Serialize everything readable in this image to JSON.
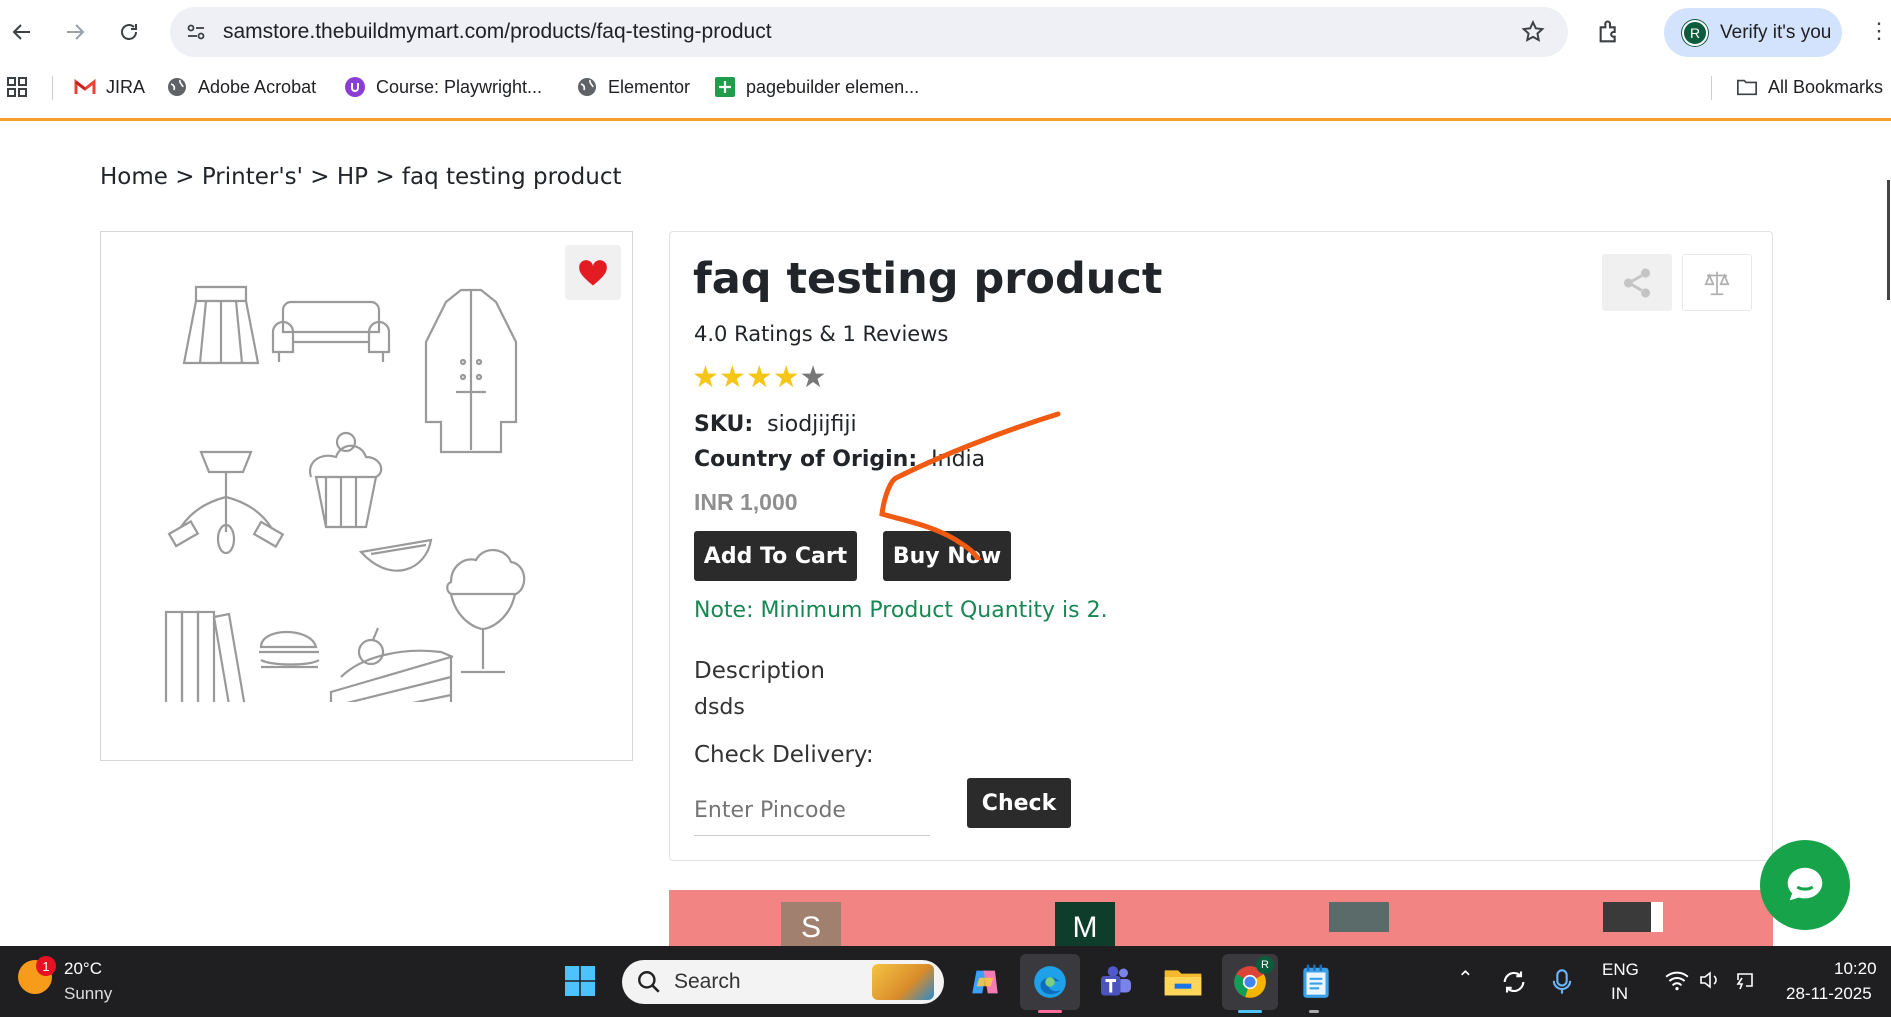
{
  "browser": {
    "url": "samstore.thebuildmymart.com/products/faq-testing-product",
    "profile_label": "Verify it's you",
    "profile_initial": "R",
    "bookmarks": [
      {
        "label": "JIRA",
        "icon": "gmail-icon"
      },
      {
        "label": "Adobe Acrobat",
        "icon": "globe-icon"
      },
      {
        "label": "Course: Playwright...",
        "icon": "course-icon"
      },
      {
        "label": "Elementor",
        "icon": "globe-icon"
      },
      {
        "label": "pagebuilder elemen...",
        "icon": "sheets-icon"
      }
    ],
    "all_bookmarks": "All Bookmarks"
  },
  "breadcrumb": "Home > Printer's' > HP > faq testing product",
  "product": {
    "title": "faq testing product",
    "ratings_text": "4.0 Ratings & 1 Reviews",
    "rating": 4,
    "rating_max": 5,
    "sku_label": "SKU:",
    "sku_value": "siodjijfiji",
    "origin_label": "Country of Origin:",
    "origin_value": "India",
    "price": "INR 1,000",
    "add_to_cart": "Add To Cart",
    "buy_now": "Buy Now",
    "note": "Note: Minimum Product Quantity is 2.",
    "description_label": "Description",
    "description_value": "dsds",
    "check_delivery_label": "Check Delivery:",
    "pincode_placeholder": "Enter Pincode",
    "check_button": "Check"
  },
  "related_tiles": [
    "S",
    "M"
  ],
  "colors": {
    "accent_orange": "#f59e2a",
    "note_green": "#198754",
    "band": "#f28584",
    "chat": "#16a34a",
    "star": "#f5c518"
  },
  "taskbar": {
    "weather_temp": "20°C",
    "weather_desc": "Sunny",
    "weather_badge": "1",
    "search_label": "Search",
    "lang_top": "ENG",
    "lang_bottom": "IN",
    "time": "10:20",
    "date": "28-11-2025"
  }
}
